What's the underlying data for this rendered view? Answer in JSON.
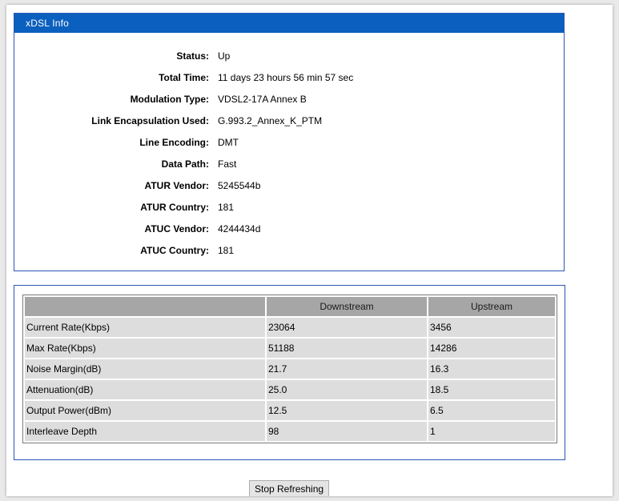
{
  "panel": {
    "title": "xDSL Info"
  },
  "info": [
    {
      "label": "Status:",
      "value": "Up"
    },
    {
      "label": "Total Time:",
      "value": "11 days 23 hours 56 min 57 sec"
    },
    {
      "label": "Modulation Type:",
      "value": "VDSL2-17A Annex B"
    },
    {
      "label": "Link Encapsulation Used:",
      "value": "G.993.2_Annex_K_PTM"
    },
    {
      "label": "Line Encoding:",
      "value": "DMT"
    },
    {
      "label": "Data Path:",
      "value": "Fast"
    },
    {
      "label": "ATUR Vendor:",
      "value": "5245544b"
    },
    {
      "label": "ATUR Country:",
      "value": "181"
    },
    {
      "label": "ATUC Vendor:",
      "value": "4244434d"
    },
    {
      "label": "ATUC Country:",
      "value": "181"
    }
  ],
  "stats": {
    "headers": [
      "",
      "Downstream",
      "Upstream"
    ],
    "rows": [
      [
        "Current Rate(Kbps)",
        "23064",
        "3456"
      ],
      [
        "Max Rate(Kbps)",
        "51188",
        "14286"
      ],
      [
        "Noise Margin(dB)",
        "21.7",
        "16.3"
      ],
      [
        "Attenuation(dB)",
        "25.0",
        "18.5"
      ],
      [
        "Output Power(dBm)",
        "12.5",
        "6.5"
      ],
      [
        "Interleave Depth",
        "98",
        "1"
      ]
    ]
  },
  "controls": {
    "stop_label": "Stop Refreshing"
  },
  "colors": {
    "header_blue": "#0b5fbe",
    "panel_border": "#2a56b4",
    "table_header": "#a6a6a6",
    "table_cell": "#dddddd"
  }
}
